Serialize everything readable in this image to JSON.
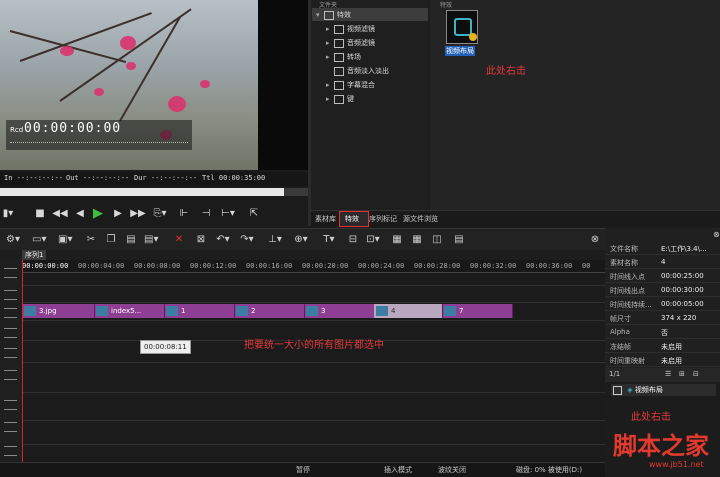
{
  "preview": {
    "rcd_label": "Rcd",
    "timecode": "00:00:00:00",
    "in_label": "In --:--:--:--",
    "out_label": "Out --:--:--:--",
    "dur_label": "Dur --:--:--:--",
    "ttl_label": "Ttl 00:00:35:00"
  },
  "library": {
    "tree_header": "文件夹",
    "tree": [
      {
        "label": "特效",
        "expanded": true,
        "selected": true
      },
      {
        "label": "视频滤镜"
      },
      {
        "label": "音频滤镜"
      },
      {
        "label": "转场"
      },
      {
        "label": "音频淡入淡出"
      },
      {
        "label": "字幕混合"
      },
      {
        "label": "键"
      }
    ],
    "content_header": "特效",
    "effect_label": "视频布局",
    "annotation": "此处右击",
    "tabs": [
      "素材库",
      "特效",
      "序列标记",
      "源文件浏览"
    ],
    "active_tab": "特效"
  },
  "timeline": {
    "sequence_tab": "序列1",
    "ruler": [
      "00:00:00:00",
      "00:00:04:00",
      "00:00:08:00",
      "00:00:12:00",
      "00:00:16:00",
      "00:00:20:00",
      "00:00:24:00",
      "00:00:28:00",
      "00:00:32:00",
      "00:00:36:00",
      "00"
    ],
    "clips": [
      {
        "label": "3.jpg"
      },
      {
        "label": "index5..."
      },
      {
        "label": "1"
      },
      {
        "label": "2"
      },
      {
        "label": "3"
      },
      {
        "label": "4"
      },
      {
        "label": "7"
      }
    ],
    "tooltip": "00:00:08:11",
    "annotation": "把要统一大小的所有图片都选中"
  },
  "status": {
    "pause": "暂停",
    "insert_mode": "插入模式",
    "ripple": "波纹关闭",
    "disk": "磁盘: 0% 被使用(D:)"
  },
  "properties": {
    "rows": [
      {
        "key": "文件名称",
        "value": "E:\\工作\\3.4\\..."
      },
      {
        "key": "素材名称",
        "value": "4"
      },
      {
        "key": "时间线入点",
        "value": "00:00:25:00"
      },
      {
        "key": "时间线出点",
        "value": "00:00:30:00"
      },
      {
        "key": "时间线持续...",
        "value": "00:00:05:00"
      },
      {
        "key": "帧尺寸",
        "value": "374 x 220"
      },
      {
        "key": "Alpha",
        "value": "否"
      },
      {
        "key": "冻结帧",
        "value": "未启用"
      },
      {
        "key": "时间重映射",
        "value": "未启用"
      }
    ]
  },
  "effects_panel": {
    "page": "1/1",
    "effect_name": "视频布局",
    "annotation": "此处右击",
    "watermark": "脚本之家",
    "watermark_url": "www.jb51.net"
  }
}
